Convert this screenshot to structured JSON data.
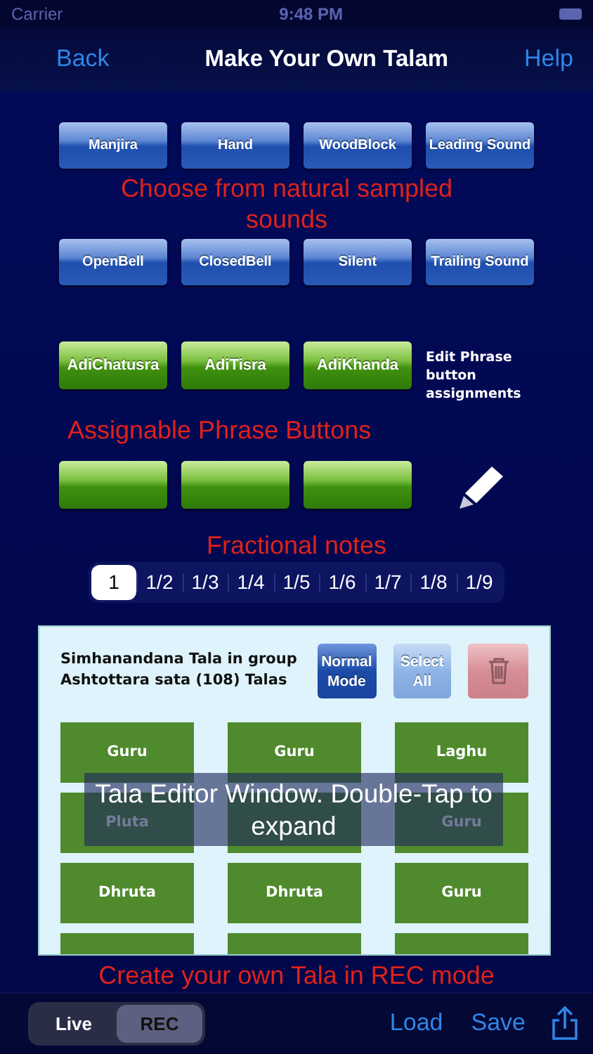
{
  "status_bar": {
    "carrier": "Carrier",
    "time": "9:48 PM"
  },
  "nav": {
    "back": "Back",
    "title": "Make Your Own Talam",
    "help": "Help"
  },
  "sound_buttons": [
    {
      "label": "Manjira"
    },
    {
      "label": "Hand"
    },
    {
      "label": "WoodBlock"
    },
    {
      "label": "Leading Sound"
    },
    {
      "label": "OpenBell"
    },
    {
      "label": "ClosedBell"
    },
    {
      "label": "Silent"
    },
    {
      "label": "Trailing Sound"
    }
  ],
  "sounds_caption": "Choose from natural sampled sounds",
  "phrase_buttons": [
    {
      "kind": "assigned",
      "label": "AdiChatusra"
    },
    {
      "kind": "assigned",
      "label": "AdiTisra"
    },
    {
      "kind": "assigned",
      "label": "AdiKhanda"
    },
    {
      "kind": "blank"
    },
    {
      "kind": "blank"
    },
    {
      "kind": "blank"
    }
  ],
  "edit_phrase_note": "Edit Phrase button assignments",
  "phrase_caption": "Assignable Phrase Buttons",
  "fractions_caption": "Fractional notes",
  "fractions": [
    {
      "label": "1",
      "selected": true
    },
    {
      "label": "1/2",
      "selected": false
    },
    {
      "label": "1/3",
      "selected": false
    },
    {
      "label": "1/4",
      "selected": false
    },
    {
      "label": "1/5",
      "selected": false
    },
    {
      "label": "1/6",
      "selected": false
    },
    {
      "label": "1/7",
      "selected": false
    },
    {
      "label": "1/8",
      "selected": false
    },
    {
      "label": "1/9",
      "selected": false
    }
  ],
  "editor": {
    "title": "Simhanandana Tala in group Ashtottara sata (108) Talas",
    "mode_button": "Normal Mode",
    "select_all_button": "Select All",
    "cells": [
      {
        "label": "Guru"
      },
      {
        "label": "Guru"
      },
      {
        "label": "Laghu"
      },
      {
        "label": "Pluta"
      },
      {},
      {
        "label": "Guru"
      },
      {
        "label": "Dhruta"
      },
      {
        "label": "Dhruta"
      },
      {
        "label": "Guru"
      },
      {},
      {},
      {}
    ],
    "overlay": "Tala Editor Window. Double-Tap to expand"
  },
  "rec_caption": "Create your own Tala in REC mode",
  "toolbar": {
    "modes": [
      {
        "label": "Live",
        "selected": false
      },
      {
        "label": "REC",
        "selected": true
      }
    ],
    "load": "Load",
    "save": "Save"
  }
}
